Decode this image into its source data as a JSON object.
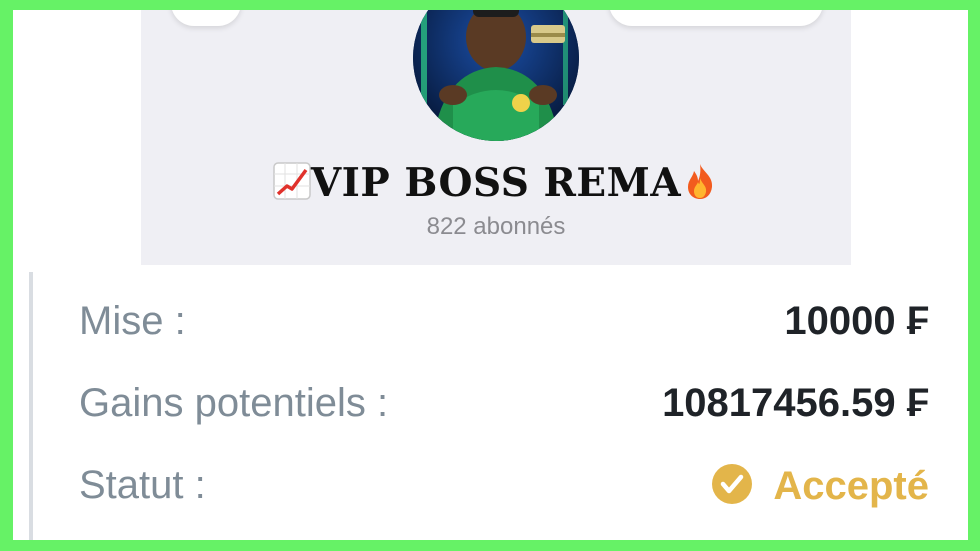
{
  "channel": {
    "title": "VIP BOSS REMA",
    "title_prefix_icon": "chart-increasing-emoji",
    "title_suffix_icon": "fire-emoji",
    "subscribers": "822 abonnés"
  },
  "bet": {
    "stake_label": "Mise :",
    "stake_value": "10000 ₣",
    "potential_gains_label": "Gains potentiels :",
    "potential_gains_value": "10817456.59 ₣",
    "status_label": "Statut :",
    "status_value": "Accepté",
    "status_icon": "check-circle-icon"
  },
  "colors": {
    "frame_border": "#66f266",
    "status_accent": "#e3b54a",
    "label_text": "#7f8c97",
    "value_text": "#1f2328"
  }
}
